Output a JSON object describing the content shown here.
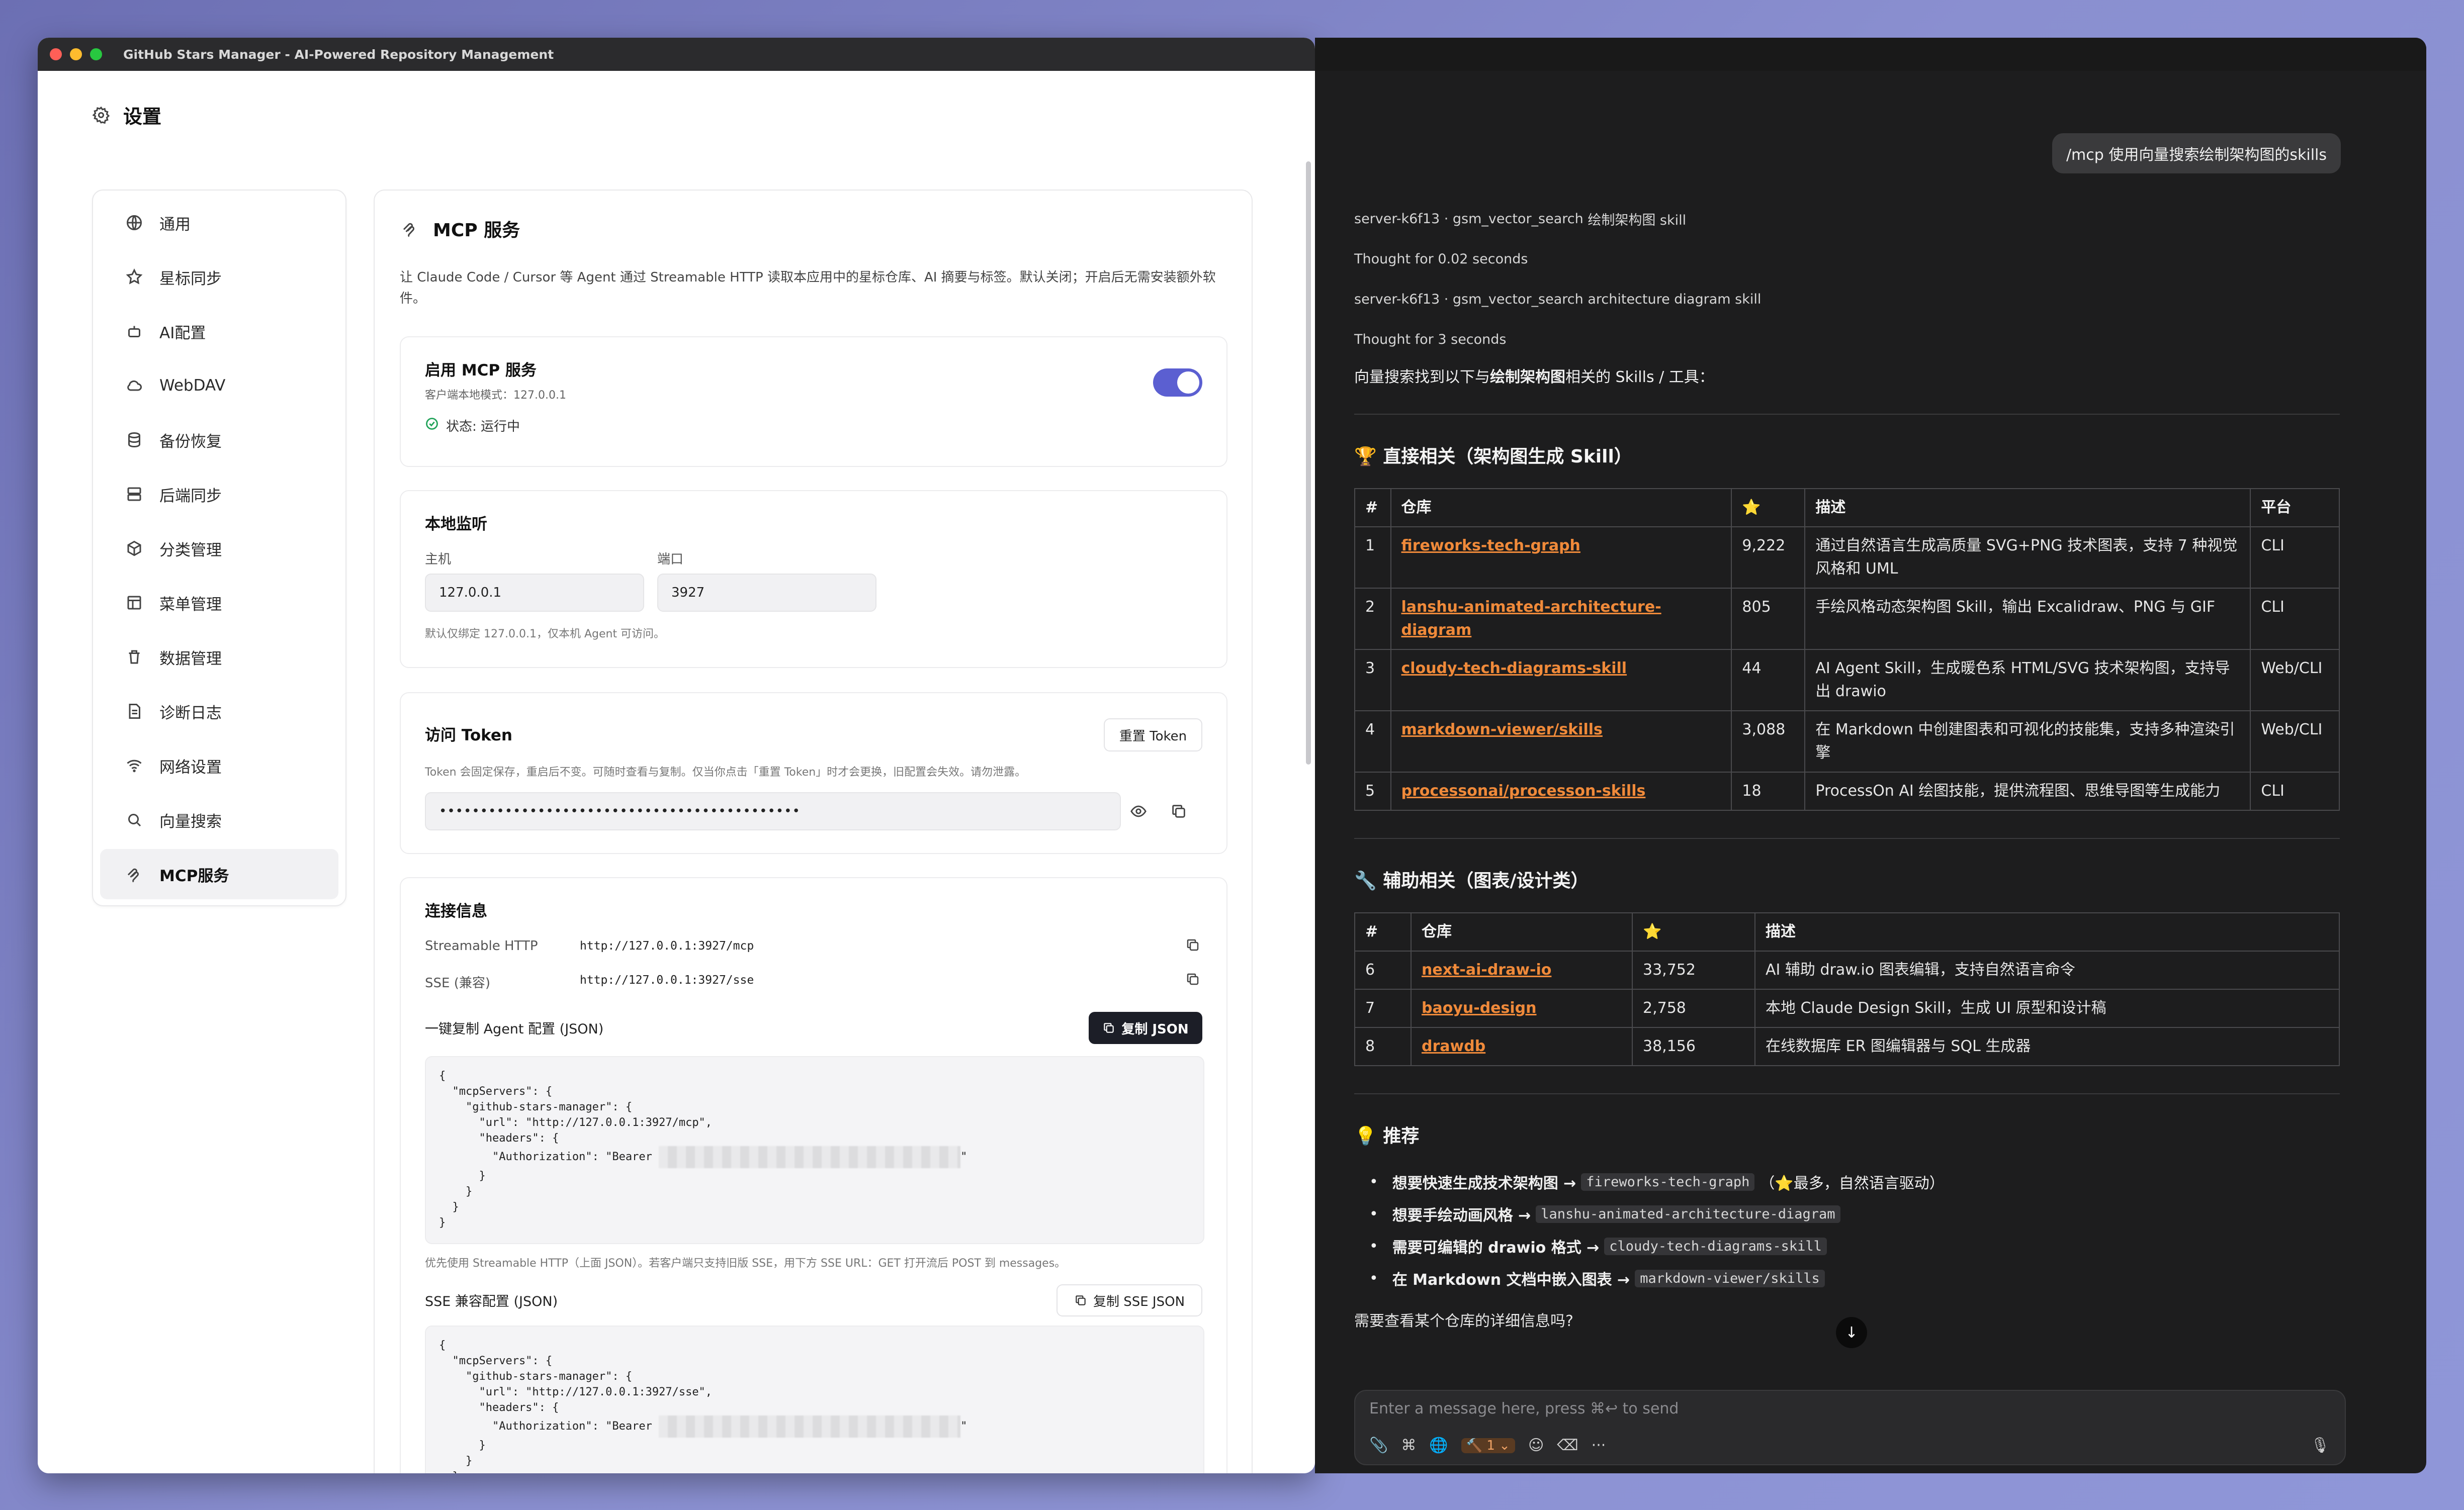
{
  "left_window": {
    "title": "GitHub Stars Manager - AI-Powered Repository Management",
    "page_title": "设置",
    "sidebar": [
      {
        "label": "通用",
        "icon": "globe-icon"
      },
      {
        "label": "星标同步",
        "icon": "star-icon"
      },
      {
        "label": "AI配置",
        "icon": "robot-icon"
      },
      {
        "label": "WebDAV",
        "icon": "cloud-icon"
      },
      {
        "label": "备份恢复",
        "icon": "database-icon"
      },
      {
        "label": "后端同步",
        "icon": "server-icon"
      },
      {
        "label": "分类管理",
        "icon": "box-icon"
      },
      {
        "label": "菜单管理",
        "icon": "layout-icon"
      },
      {
        "label": "数据管理",
        "icon": "trash-icon"
      },
      {
        "label": "诊断日志",
        "icon": "log-icon"
      },
      {
        "label": "网络设置",
        "icon": "wifi-icon"
      },
      {
        "label": "向量搜索",
        "icon": "search-icon"
      },
      {
        "label": "MCP服务",
        "icon": "mcp-icon",
        "active": true
      }
    ],
    "main": {
      "title": "MCP 服务",
      "description": "让 Claude Code / Cursor 等 Agent 通过 Streamable HTTP 读取本应用中的星标仓库、AI 摘要与标签。默认关闭；开启后无需安装额外软件。",
      "enable": {
        "title": "启用 MCP 服务",
        "subtitle": "客户端本地模式：127.0.0.1",
        "status": "状态: 运行中",
        "enabled": true
      },
      "listen": {
        "title": "本地监听",
        "host_label": "主机",
        "host_value": "127.0.0.1",
        "port_label": "端口",
        "port_value": "3927",
        "hint": "默认仅绑定 127.0.0.1，仅本机 Agent 可访问。"
      },
      "token": {
        "title": "访问 Token",
        "reset_label": "重置 Token",
        "hint": "Token 会固定保存，重启后不变。可随时查看与复制。仅当你点击「重置 Token」时才会更换，旧配置会失效。请勿泄露。",
        "masked": "••••••••••••••••••••••••••••••••••••••••••••"
      },
      "connection": {
        "title": "连接信息",
        "streamable_label": "Streamable HTTP",
        "streamable_url": "http://127.0.0.1:3927/mcp",
        "sse_label": "SSE (兼容)",
        "sse_url": "http://127.0.0.1:3927/sse",
        "agent_config_label": "一键复制 Agent 配置 (JSON)",
        "copy_json_label": "复制 JSON",
        "json_lines": [
          "{",
          "  \"mcpServers\": {",
          "    \"github-stars-manager\": {",
          "      \"url\": \"http://127.0.0.1:3927/mcp\",",
          "      \"headers\": {",
          "        \"Authorization\": \"Bearer "
        ],
        "json_tail": [
          "      }",
          "    }",
          "  }",
          "}"
        ],
        "prefer_hint": "优先使用 Streamable HTTP（上面 JSON）。若客户端只支持旧版 SSE，用下方 SSE URL：GET 打开流后 POST 到 messages。",
        "sse_config_label": "SSE 兼容配置 (JSON)",
        "copy_sse_label": "复制 SSE JSON",
        "sse_json_lines": [
          "{",
          "  \"mcpServers\": {",
          "    \"github-stars-manager\": {",
          "      \"url\": \"http://127.0.0.1:3927/sse\",",
          "      \"headers\": {",
          "        \"Authorization\": \"Bearer "
        ],
        "sse_json_tail": [
          "      }",
          "    }",
          "  }",
          "}"
        ]
      }
    }
  },
  "right_window": {
    "user_message": "/mcp 使用向量搜索绘制架构图的skills",
    "steps": [
      {
        "tool": "server-k6f13 · gsm_vector_search",
        "arg": "绘制架构图 skill"
      },
      {
        "thought": "Thought for 0.02 seconds"
      },
      {
        "tool": "server-k6f13 · gsm_vector_search",
        "arg": "architecture diagram skill"
      },
      {
        "thought": "Thought for 3 seconds"
      }
    ],
    "lead_pre": "向量搜索找到以下与",
    "lead_bold": "绘制架构图",
    "lead_post": "相关的 Skills / 工具：",
    "section1_title": "🏆 直接相关（架构图生成 Skill）",
    "section2_title": "🔧 辅助相关（图表/设计类）",
    "section3_title": "💡 推荐",
    "table1_headers": [
      "#",
      "仓库",
      "⭐",
      "描述",
      "平台"
    ],
    "table1_rows": [
      [
        "1",
        "fireworks-tech-graph",
        "9,222",
        "通过自然语言生成高质量 SVG+PNG 技术图表，支持 7 种视觉风格和 UML",
        "CLI"
      ],
      [
        "2",
        "lanshu-animated-architecture-diagram",
        "805",
        "手绘风格动态架构图 Skill，输出 Excalidraw、PNG 与 GIF",
        "CLI"
      ],
      [
        "3",
        "cloudy-tech-diagrams-skill",
        "44",
        "AI Agent Skill，生成暖色系 HTML/SVG 技术架构图，支持导出 drawio",
        "Web/CLI"
      ],
      [
        "4",
        "markdown-viewer/skills",
        "3,088",
        "在 Markdown 中创建图表和可视化的技能集，支持多种渲染引擎",
        "Web/CLI"
      ],
      [
        "5",
        "processonai/processon-skills",
        "18",
        "ProcessOn AI 绘图技能，提供流程图、思维导图等生成能力",
        "CLI"
      ]
    ],
    "table2_headers": [
      "#",
      "仓库",
      "⭐",
      "描述"
    ],
    "table2_rows": [
      [
        "6",
        "next-ai-draw-io",
        "33,752",
        "AI 辅助 draw.io 图表编辑，支持自然语言命令"
      ],
      [
        "7",
        "baoyu-design",
        "2,758",
        "本地 Claude Design Skill，生成 UI 原型和设计稿"
      ],
      [
        "8",
        "drawdb",
        "38,156",
        "在线数据库 ER 图编辑器与 SQL 生成器"
      ]
    ],
    "recommendations": [
      {
        "text": "想要快速生成技术架构图 →",
        "code": "fireworks-tech-graph",
        "suffix": "（⭐最多，自然语言驱动）"
      },
      {
        "text": "想要手绘动画风格 →",
        "code": "lanshu-animated-architecture-diagram",
        "suffix": ""
      },
      {
        "text": "需要可编辑的 drawio 格式 →",
        "code": "cloudy-tech-diagrams-skill",
        "suffix": ""
      },
      {
        "text": "在 Markdown 文档中嵌入图表 →",
        "code": "markdown-viewer/skills",
        "suffix": ""
      }
    ],
    "question": "需要查看某个仓库的详细信息吗?",
    "composer_placeholder": "Enter a message here, press ⌘↩ to send",
    "tool_badge": "1"
  }
}
